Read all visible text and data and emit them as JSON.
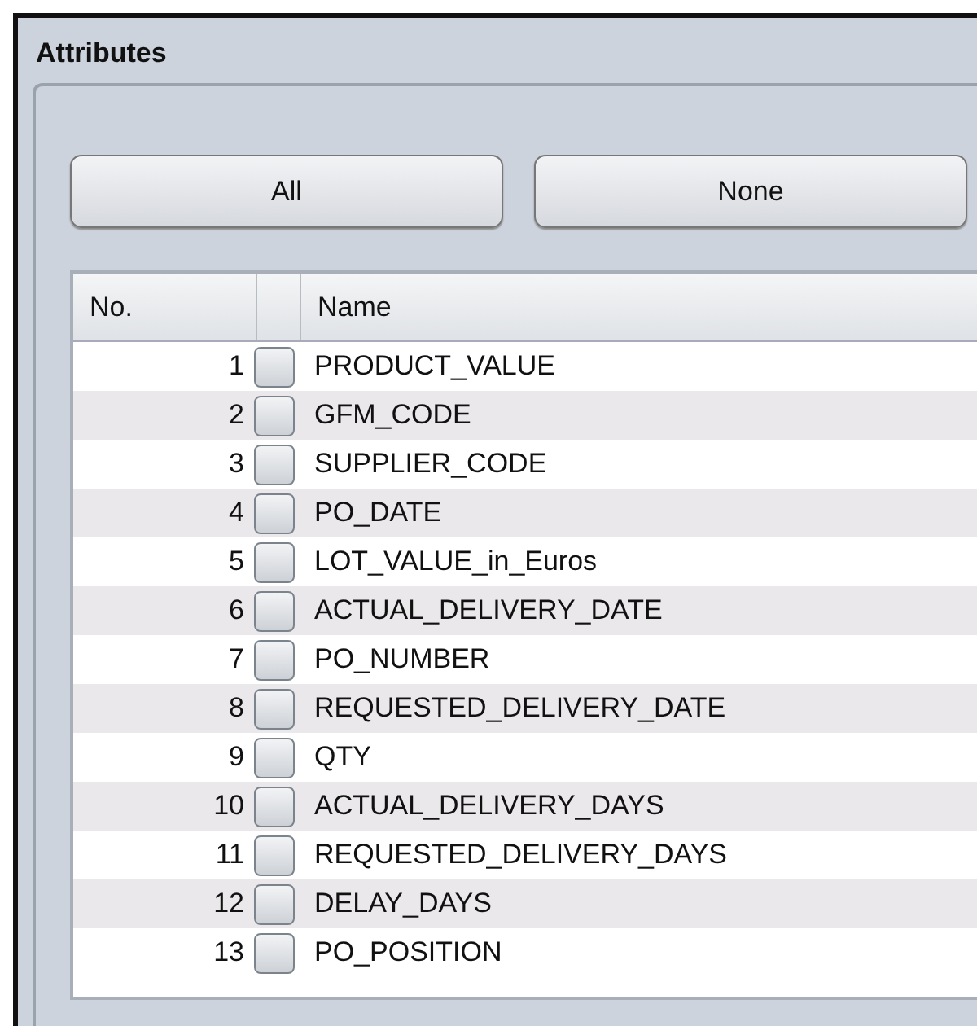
{
  "panel": {
    "title": "Attributes"
  },
  "buttons": [
    "All",
    "None"
  ],
  "table": {
    "columns": [
      "No.",
      "Name"
    ],
    "rows": [
      {
        "number": "1",
        "name": "PRODUCT_VALUE",
        "checked": false
      },
      {
        "number": "2",
        "name": "GFM_CODE",
        "checked": false
      },
      {
        "number": "3",
        "name": "SUPPLIER_CODE",
        "checked": false
      },
      {
        "number": "4",
        "name": "PO_DATE",
        "checked": false
      },
      {
        "number": "5",
        "name": "LOT_VALUE_in_Euros",
        "checked": false
      },
      {
        "number": "6",
        "name": "ACTUAL_DELIVERY_DATE",
        "checked": false
      },
      {
        "number": "7",
        "name": "PO_NUMBER",
        "checked": false
      },
      {
        "number": "8",
        "name": "REQUESTED_DELIVERY_DATE",
        "checked": false
      },
      {
        "number": "9",
        "name": "QTY",
        "checked": false
      },
      {
        "number": "10",
        "name": "ACTUAL_DELIVERY_DAYS",
        "checked": false
      },
      {
        "number": "11",
        "name": "REQUESTED_DELIVERY_DAYS",
        "checked": false
      },
      {
        "number": "12",
        "name": "DELAY_DAYS",
        "checked": false
      },
      {
        "number": "13",
        "name": "PO_POSITION",
        "checked": false
      }
    ]
  }
}
